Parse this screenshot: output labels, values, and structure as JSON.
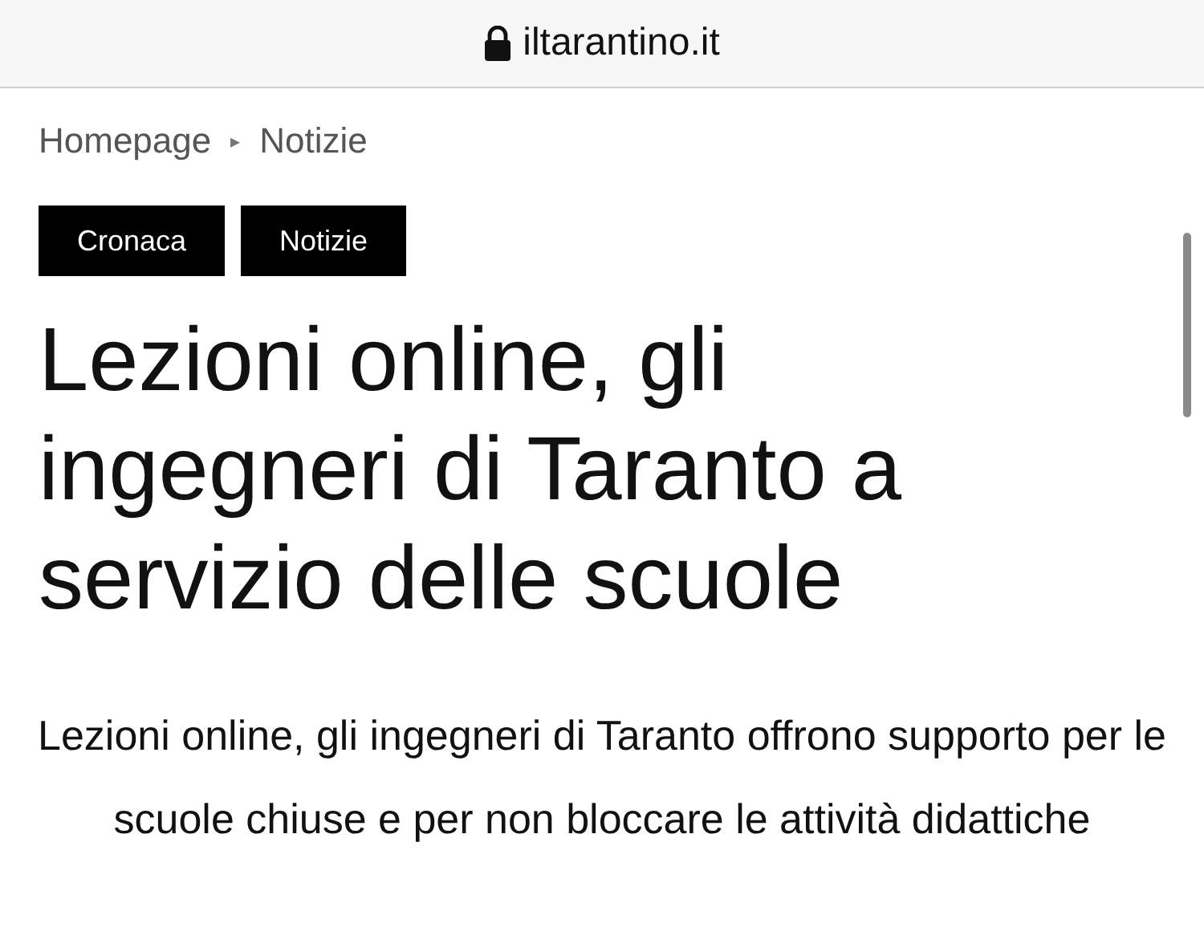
{
  "address_bar": {
    "url": "iltarantino.it"
  },
  "breadcrumb": [
    {
      "label": "Homepage"
    },
    {
      "label": "Notizie"
    }
  ],
  "breadcrumb_separator": "▸",
  "tags": [
    {
      "label": "Cronaca"
    },
    {
      "label": "Notizie"
    }
  ],
  "title": "Lezioni online, gli ingegneri di Taranto a servizio delle scuole",
  "subtitle": "Lezioni online, gli ingegneri di Taranto offrono supporto per le scuole chiuse e per non bloccare le attività didattiche"
}
